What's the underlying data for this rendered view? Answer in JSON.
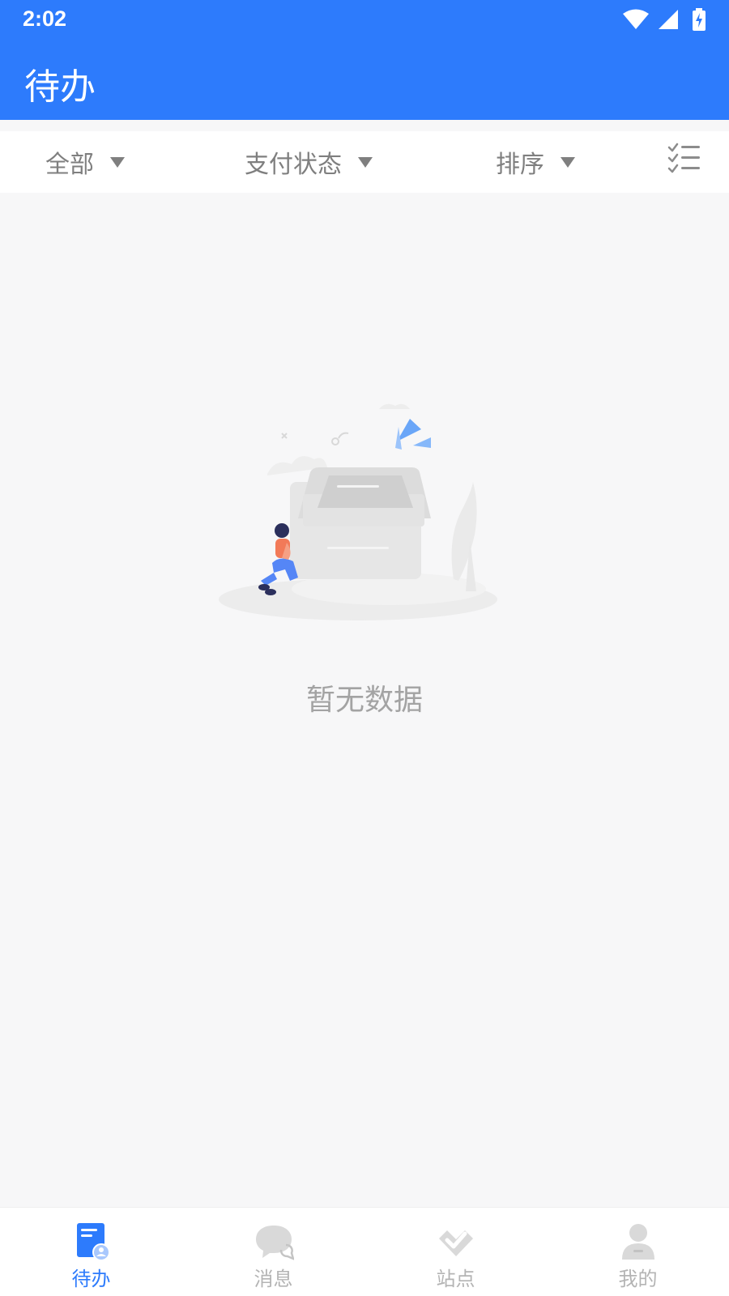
{
  "status_bar": {
    "time": "2:02",
    "icons": [
      "wifi-icon",
      "cellular-signal-icon",
      "battery-charging-icon"
    ]
  },
  "header": {
    "title": "待办",
    "color": "#2d7bfc"
  },
  "filters": {
    "all_label": "全部",
    "payment_status_label": "支付状态",
    "sort_label": "排序",
    "list_icon": "checklist-icon"
  },
  "empty_state": {
    "illustration": "empty-inbox-illustration",
    "text": "暂无数据"
  },
  "bottom_nav": {
    "items": [
      {
        "label": "待办",
        "icon": "todo-icon",
        "active": true
      },
      {
        "label": "消息",
        "icon": "message-icon",
        "active": false
      },
      {
        "label": "站点",
        "icon": "site-icon",
        "active": false
      },
      {
        "label": "我的",
        "icon": "profile-icon",
        "active": false
      }
    ],
    "active_color": "#2d7bfc",
    "inactive_color": "#b4b4b4"
  }
}
